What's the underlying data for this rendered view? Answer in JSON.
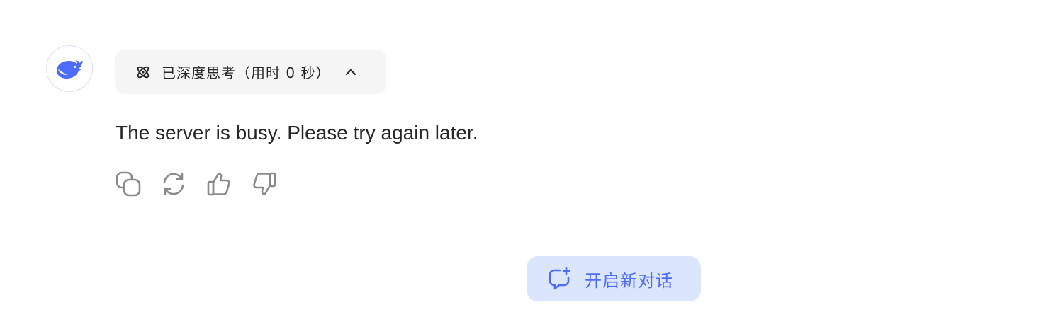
{
  "assistant": {
    "avatar_icon": "whale-logo-icon",
    "brand_color": "#4d6bfe"
  },
  "thinking": {
    "label": "已深度思考（用时 0 秒）",
    "icon": "atom-icon",
    "toggle_icon": "chevron-up-icon"
  },
  "message": {
    "text": "The server is busy. Please try again later."
  },
  "actions": [
    {
      "name": "copy",
      "icon": "copy-icon"
    },
    {
      "name": "regenerate",
      "icon": "refresh-icon"
    },
    {
      "name": "like",
      "icon": "thumbs-up-icon"
    },
    {
      "name": "dislike",
      "icon": "thumbs-down-icon"
    }
  ],
  "new_chat": {
    "label": "开启新对话",
    "icon": "new-chat-icon",
    "color": "#4d6bfe",
    "background": "#dbe6fd"
  }
}
